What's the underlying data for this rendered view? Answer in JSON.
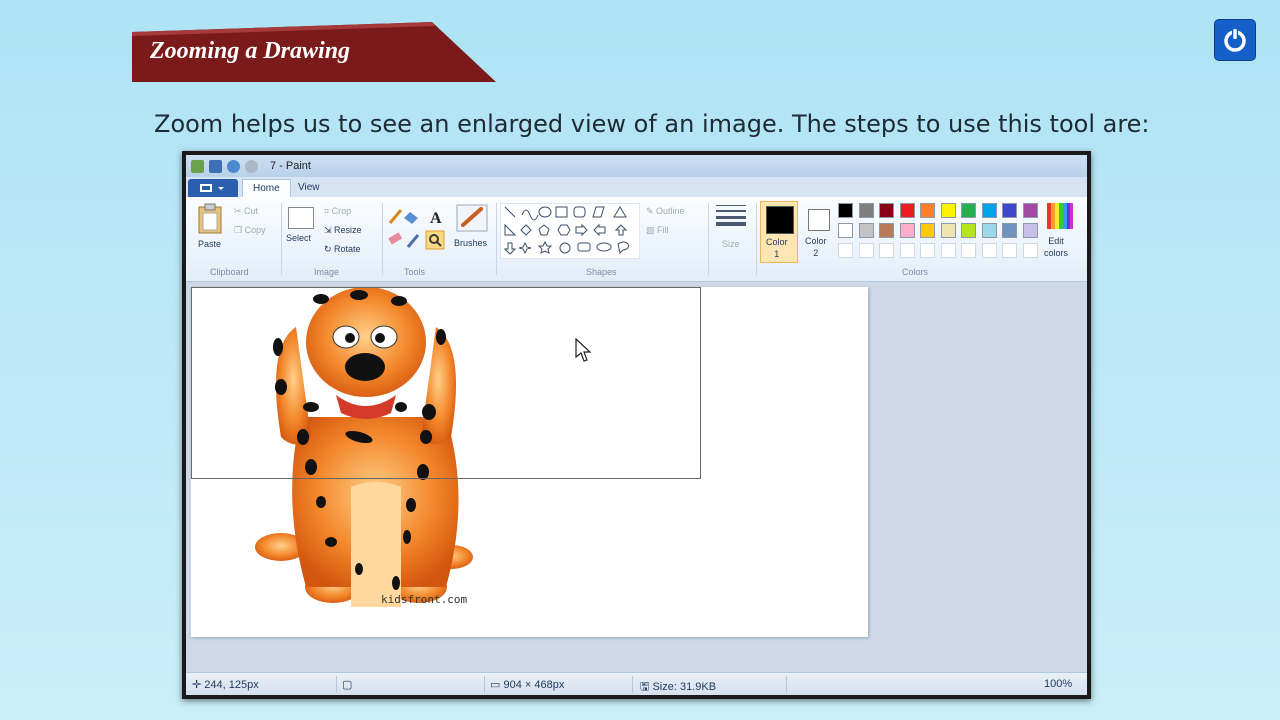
{
  "slide": {
    "title": "Zooming a Drawing",
    "intro": "Zoom helps us to see an enlarged view of an image. The steps to use this tool are:",
    "accent": "#7a1a1a"
  },
  "paint": {
    "window_title": "7 - Paint",
    "tabs": [
      "Home",
      "View"
    ],
    "clipboard": {
      "paste": "Paste",
      "cut": "Cut",
      "copy": "Copy",
      "label": "Clipboard"
    },
    "image": {
      "select": "Select",
      "crop": "Crop",
      "resize": "Resize",
      "rotate": "Rotate",
      "label": "Image"
    },
    "tools": {
      "label": "Tools",
      "brushes": "Brushes"
    },
    "shapes": {
      "outline": "Outline",
      "fill": "Fill",
      "label": "Shapes"
    },
    "size": {
      "label": "Size"
    },
    "colors": {
      "color1_label": "Color\n1",
      "color2_label": "Color\n2",
      "edit": "Edit\ncolors",
      "label": "Colors",
      "palette_row1": [
        "#000000",
        "#7f7f7f",
        "#880015",
        "#ed1c24",
        "#ff7f27",
        "#fff200",
        "#22b14c",
        "#00a2e8",
        "#3f48cc",
        "#a349a4"
      ],
      "palette_row2": [
        "#ffffff",
        "#c3c3c3",
        "#b97a57",
        "#ffaec9",
        "#ffc90e",
        "#efe4b0",
        "#b5e61d",
        "#99d9ea",
        "#7092be",
        "#c8bfe7"
      ]
    },
    "watermark": "kidsfront.com",
    "status": {
      "position": "244, 125px",
      "dimensions": "904 × 468px",
      "size": "Size: 31.9KB",
      "zoom": "100%"
    }
  }
}
